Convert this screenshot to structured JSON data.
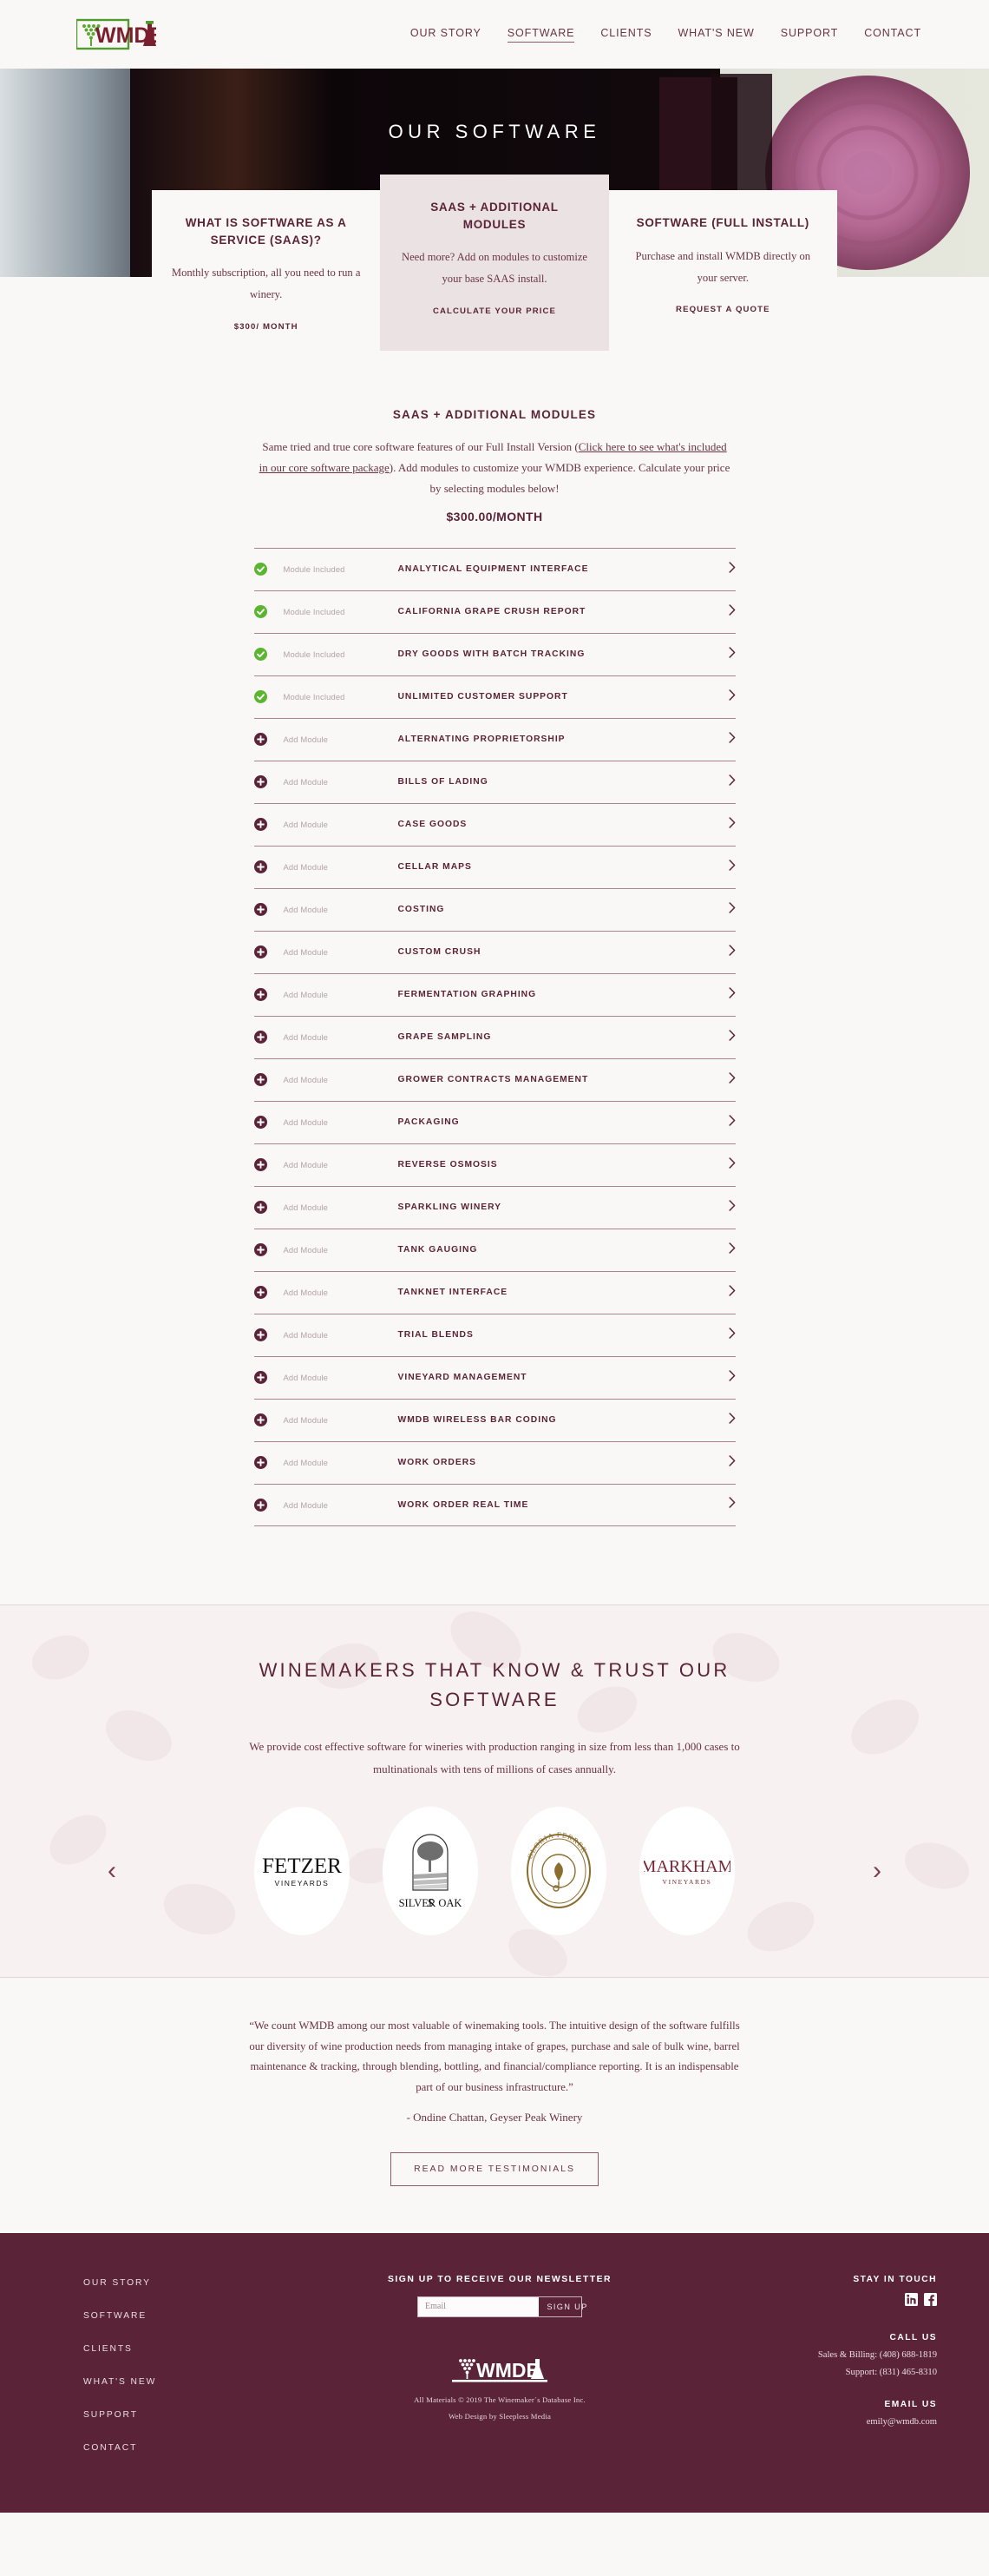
{
  "header": {
    "logo_text": "WMDB",
    "nav": [
      {
        "label": "OUR STORY",
        "active": false
      },
      {
        "label": "SOFTWARE",
        "active": true
      },
      {
        "label": "CLIENTS",
        "active": false
      },
      {
        "label": "WHAT'S NEW",
        "active": false
      },
      {
        "label": "SUPPORT",
        "active": false
      },
      {
        "label": "CONTACT",
        "active": false
      }
    ]
  },
  "hero": {
    "title": "OUR SOFTWARE"
  },
  "cards": [
    {
      "title": "WHAT IS SOFTWARE AS A SERVICE (SAAS)?",
      "body": "Monthly subscription, all you need to run a winery.",
      "cta": "$300/ MONTH"
    },
    {
      "title": "SAAS + ADDITIONAL MODULES",
      "body": "Need more? Add on modules to customize your base SAAS install.",
      "cta": "CALCULATE YOUR PRICE"
    },
    {
      "title": "SOFTWARE (FULL INSTALL)",
      "body": "Purchase and install WMDB directly on your server.",
      "cta": "REQUEST A QUOTE"
    }
  ],
  "modules_section": {
    "heading": "SAAS + ADDITIONAL MODULES",
    "lede_part1": "Same tried and true core software features of our Full Install Version (",
    "lede_link": "Click here to see what's included in our core software package",
    "lede_part2": "). Add modules to customize your WMDB experience. Calculate your price by selecting modules below!",
    "price": "$300.00/MONTH",
    "status_included": "Module Included",
    "status_add": "Add Module",
    "modules": [
      {
        "name": "ANALYTICAL EQUIPMENT INTERFACE",
        "included": true
      },
      {
        "name": "CALIFORNIA GRAPE CRUSH REPORT",
        "included": true
      },
      {
        "name": "DRY GOODS WITH BATCH TRACKING",
        "included": true
      },
      {
        "name": "UNLIMITED CUSTOMER SUPPORT",
        "included": true
      },
      {
        "name": "ALTERNATING PROPRIETORSHIP",
        "included": false
      },
      {
        "name": "BILLS OF LADING",
        "included": false
      },
      {
        "name": "CASE GOODS",
        "included": false
      },
      {
        "name": "CELLAR MAPS",
        "included": false
      },
      {
        "name": "COSTING",
        "included": false
      },
      {
        "name": "CUSTOM CRUSH",
        "included": false
      },
      {
        "name": "FERMENTATION GRAPHING",
        "included": false
      },
      {
        "name": "GRAPE SAMPLING",
        "included": false
      },
      {
        "name": "GROWER CONTRACTS MANAGEMENT",
        "included": false
      },
      {
        "name": "PACKAGING",
        "included": false
      },
      {
        "name": "REVERSE OSMOSIS",
        "included": false
      },
      {
        "name": "SPARKLING WINERY",
        "included": false
      },
      {
        "name": "TANK GAUGING",
        "included": false
      },
      {
        "name": "TANKNET INTERFACE",
        "included": false
      },
      {
        "name": "TRIAL BLENDS",
        "included": false
      },
      {
        "name": "VINEYARD MANAGEMENT",
        "included": false
      },
      {
        "name": "WMDB WIRELESS BAR CODING",
        "included": false
      },
      {
        "name": "WORK ORDERS",
        "included": false
      },
      {
        "name": "WORK ORDER REAL TIME",
        "included": false
      }
    ]
  },
  "trust": {
    "heading": "WINEMAKERS THAT KNOW & TRUST OUR SOFTWARE",
    "body": "We provide cost effective software for wineries with production ranging in size from less than 1,000 cases to multinationals with tens of millions of cases annually.",
    "prev_label": "‹",
    "next_label": "›",
    "clients": [
      {
        "name": "FETZER",
        "sub": "VINEYARDS"
      },
      {
        "name": "SILVER OAK",
        "sub": ""
      },
      {
        "name": "GLORIA FERRER",
        "sub": ""
      },
      {
        "name": "MARKHAM",
        "sub": "VINEYARDS"
      }
    ]
  },
  "testimonial": {
    "quote": "“We count WMDB among our most valuable of winemaking tools. The intuitive design of the software fulfills our diversity of wine production needs from managing intake of grapes, purchase and sale of bulk wine, barrel maintenance & tracking, through blending, bottling, and financial/compliance reporting. It is an indispensable part of our business infrastructure.”",
    "attribution": "- Ondine Chattan, Geyser Peak Winery",
    "button": "READ MORE TESTIMONIALS"
  },
  "footer": {
    "links": [
      {
        "label": "OUR STORY"
      },
      {
        "label": "SOFTWARE"
      },
      {
        "label": "CLIENTS"
      },
      {
        "label": "WHAT'S NEW"
      },
      {
        "label": "SUPPORT"
      },
      {
        "label": "CONTACT"
      }
    ],
    "newsletter_heading": "SIGN UP TO RECEIVE OUR NEWSLETTER",
    "email_placeholder": "Email",
    "signup_button": "SIGN UP",
    "logo_text": "WMDB",
    "copyright": "All Materials © 2019 The Winemaker´s Database Inc.",
    "credit": "Web Design by Sleepless Media",
    "stay_heading": "STAY IN TOUCH",
    "call_heading": "CALL US",
    "call_sales": "Sales & Billing: (408) 688-1819",
    "call_support": "Support: (831) 465-8310",
    "email_heading": "EMAIL US",
    "email_address": "emily@wmdb.com"
  },
  "colors": {
    "brand": "#5b2338",
    "accent": "#8d5a6b",
    "included_green": "#5cb531",
    "page_bg": "#faf8f6",
    "card_mid_bg": "#ebe3e3"
  }
}
